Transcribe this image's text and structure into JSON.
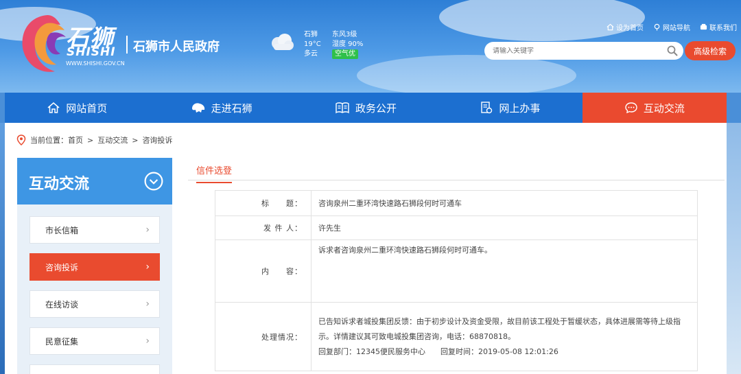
{
  "header": {
    "brand_cn": "石狮",
    "brand_en": "SHISHI",
    "brand_url": "WWW.SHISHI.GOV.CN",
    "gov_name": "石狮市人民政府",
    "weather": {
      "city": "石狮",
      "temp": "19°C",
      "cond": "多云",
      "wind": "东风3级",
      "humidity": "湿度 90%",
      "air": "空气优"
    },
    "links": [
      {
        "label": "设为首页",
        "icon": "home-icon"
      },
      {
        "label": "网站导航",
        "icon": "location-icon"
      },
      {
        "label": "联系我们",
        "icon": "phone-icon"
      }
    ],
    "search_placeholder": "请输入关键字",
    "adv_search": "高级检索"
  },
  "nav": [
    {
      "label": "网站首页",
      "icon": "home-icon"
    },
    {
      "label": "走进石狮",
      "icon": "lion-icon"
    },
    {
      "label": "政务公开",
      "icon": "book-icon"
    },
    {
      "label": "网上办事",
      "icon": "service-icon"
    },
    {
      "label": "互动交流",
      "icon": "chat-icon",
      "active": true
    }
  ],
  "breadcrumb": {
    "prefix": "当前位置：",
    "items": [
      "首页",
      "互动交流",
      "咨询投诉"
    ],
    "sep": ">"
  },
  "sidebar": {
    "title": "互动交流",
    "items": [
      {
        "label": "市长信箱"
      },
      {
        "label": "咨询投诉",
        "active": true
      },
      {
        "label": "在线访谈"
      },
      {
        "label": "民意征集"
      }
    ]
  },
  "tab": "信件选登",
  "letter": {
    "title_key": "标　　题：",
    "title": "咨询泉州二重环湾快速路石狮段何时可通车",
    "sender_key": "发 件 人：",
    "sender": "许先生",
    "content_key": "内　　容：",
    "content": "诉求者咨询泉州二重环湾快速路石狮段何时可通车。",
    "handle_key": "处理情况：",
    "handle_1": "已告知诉求者城投集团反馈：由于初步设计及资金受限，故目前该工程处于暂缓状态，具体进展需等待上级指示。详情建议其可致电城投集团咨询，电话：68870818。",
    "handle_2": "回复部门：12345便民服务中心　　回复时间：2019-05-08 12:01:26"
  }
}
